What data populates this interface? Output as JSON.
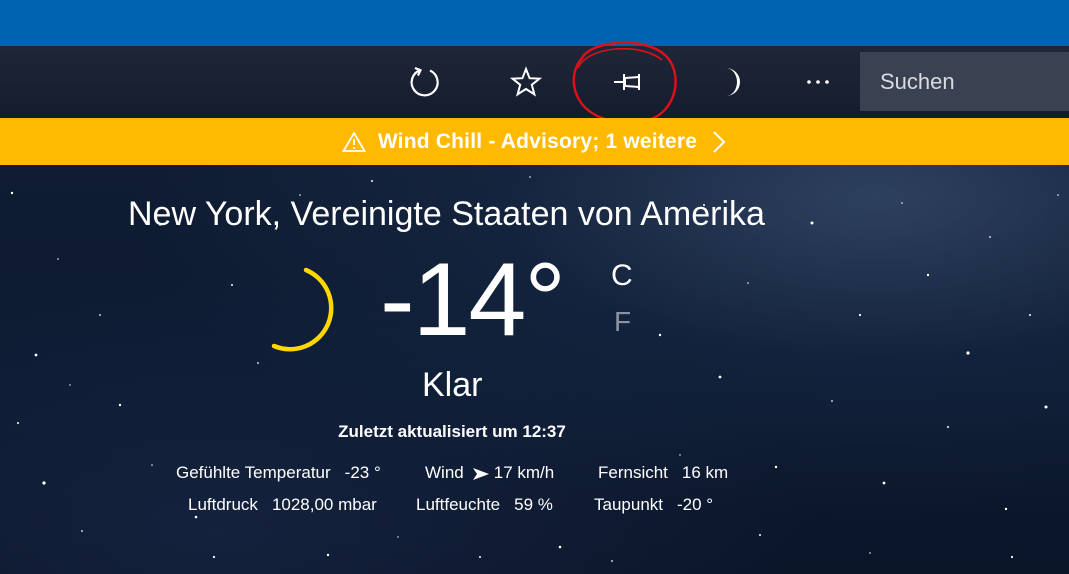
{
  "toolbar": {
    "refresh_icon": "refresh-icon",
    "favorite_icon": "star-icon",
    "pin_icon": "pin-icon",
    "theme_icon": "moon-icon",
    "more_icon": "more-icon",
    "more_label": "···",
    "search_placeholder": "Suchen"
  },
  "alert": {
    "icon": "warning-icon",
    "text": "Wind Chill - Advisory; 1 weitere",
    "color": "#ffb900"
  },
  "weather": {
    "location": "New York, Vereinigte Staaten von Amerika",
    "condition_icon": "moon-icon",
    "temperature": "-14°",
    "unit_c": "C",
    "unit_f": "F",
    "condition": "Klar",
    "updated": "Zuletzt aktualisiert um 12:37",
    "details": {
      "feels_like_label": "Gefühlte Temperatur",
      "feels_like_value": "-23 °",
      "wind_label": "Wind",
      "wind_value": "17 km/h",
      "visibility_label": "Fernsicht",
      "visibility_value": "16 km",
      "pressure_label": "Luftdruck",
      "pressure_value": "1028,00 mbar",
      "humidity_label": "Luftfeuchte",
      "humidity_value": "59 %",
      "dewpoint_label": "Taupunkt",
      "dewpoint_value": "-20 °"
    }
  },
  "colors": {
    "titlebar": "#0063b1",
    "moon": "#ffd800",
    "annotation": "#e0101a"
  }
}
